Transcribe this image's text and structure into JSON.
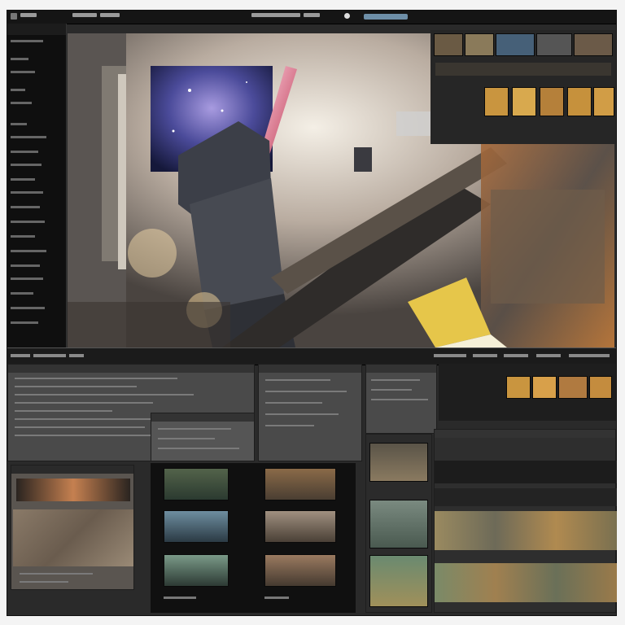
{
  "app": {
    "accent_search": "#6e8fa8",
    "chrome_dark": "#151515",
    "panel_gray": "#4a4a4a"
  },
  "icons": [
    "app-logo-icon",
    "search-icon",
    "settings-icon"
  ],
  "layout_regions": {
    "viewport": "3d-scene-viewport",
    "left_sidebar": "tool-sidebar",
    "right_strip": "asset-thumbnail-strip",
    "lower_panels": "editor-panels",
    "media_grid": "media-thumbnail-grid"
  }
}
